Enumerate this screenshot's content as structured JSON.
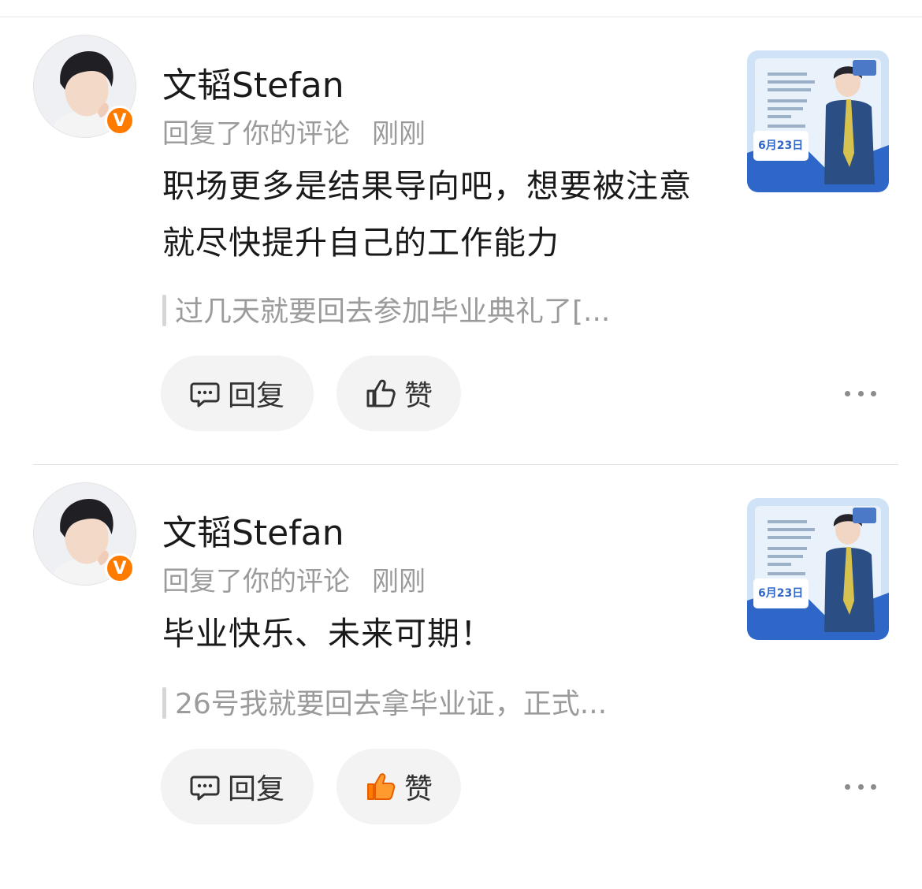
{
  "comments": [
    {
      "user_name": "文韬Stefan",
      "verified_badge": "V",
      "action": "回复了你的评论",
      "time": "刚刚",
      "text": "职场更多是结果导向吧，想要被注意就尽快提升自己的工作能力",
      "quoted": "过几天就要回去参加毕业典礼了[...",
      "reply_label": "回复",
      "like_label": "赞",
      "liked": false,
      "thumbnail_date": "6月23日"
    },
    {
      "user_name": "文韬Stefan",
      "verified_badge": "V",
      "action": "回复了你的评论",
      "time": "刚刚",
      "text": "毕业快乐、未来可期！",
      "quoted": "26号我就要回去拿毕业证，正式...",
      "reply_label": "回复",
      "like_label": "赞",
      "liked": true,
      "thumbnail_date": "6月23日"
    }
  ],
  "colors": {
    "accent_orange": "#ff7b00",
    "muted_text": "#9b9b9b",
    "button_bg": "#f3f3f3",
    "thumbnail_blue": "#2f67c9"
  },
  "icons": [
    "comment-icon",
    "thumbs-up-icon",
    "more-dots-icon"
  ]
}
